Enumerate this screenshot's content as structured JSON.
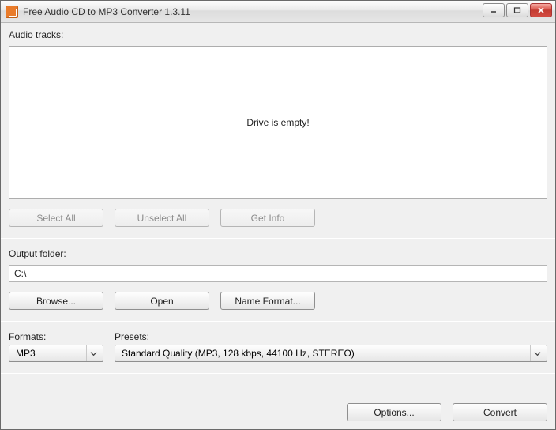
{
  "window": {
    "title": "Free Audio CD to MP3 Converter 1.3.11"
  },
  "tracks": {
    "label": "Audio tracks:",
    "empty_message": "Drive is empty!"
  },
  "track_buttons": {
    "select_all": "Select All",
    "unselect_all": "Unselect All",
    "get_info": "Get Info"
  },
  "output": {
    "label": "Output folder:",
    "path": "C:\\",
    "browse": "Browse...",
    "open": "Open",
    "name_format": "Name Format..."
  },
  "formats": {
    "formats_label": "Formats:",
    "format_value": "MP3",
    "presets_label": "Presets:",
    "preset_value": "Standard Quality (MP3, 128 kbps, 44100 Hz, STEREO)"
  },
  "footer": {
    "options": "Options...",
    "convert": "Convert"
  }
}
